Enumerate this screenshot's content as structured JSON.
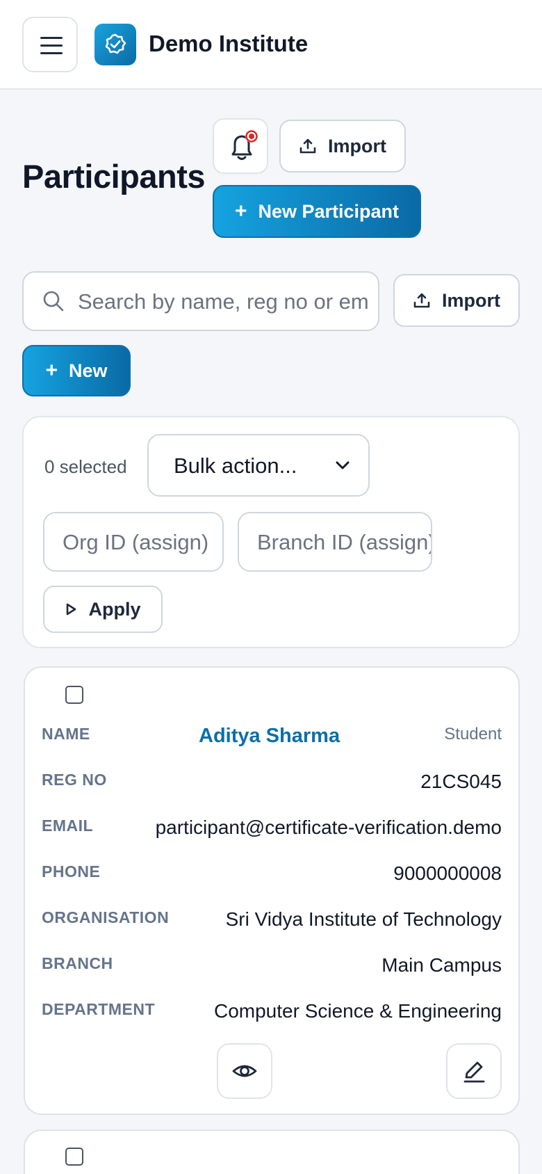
{
  "header": {
    "brand": "Demo Institute",
    "logo_icon": "shield-check-icon",
    "menu_icon": "hamburger-icon"
  },
  "page": {
    "title": "Participants",
    "notification_icon": "bell-icon",
    "import_label": "Import",
    "new_participant_label": "New Participant"
  },
  "toolbar": {
    "search_placeholder": "Search by name, reg no or email",
    "import_label": "Import",
    "new_label": "New"
  },
  "bulk": {
    "selected_text": "0 selected",
    "bulk_action_value": "Bulk action...",
    "org_placeholder": "Org ID (assign)",
    "branch_placeholder": "Branch ID (assign)",
    "apply_label": "Apply"
  },
  "participants": [
    {
      "name_label": "NAME",
      "name": "Aditya Sharma",
      "role": "Student",
      "reg_label": "REG NO",
      "reg_no": "21CS045",
      "email_label": "EMAIL",
      "email": "participant@certificate-verification.demo",
      "phone_label": "PHONE",
      "phone": "9000000008",
      "org_label": "ORGANISATION",
      "organisation": "Sri Vidya Institute of Technology",
      "branch_label": "BRANCH",
      "branch": "Main Campus",
      "dept_label": "DEPARTMENT",
      "department": "Computer Science & Engineering"
    }
  ],
  "colors": {
    "primary": "#0a6aa5",
    "accent": "#15a3e0",
    "alert": "#dc2626"
  }
}
